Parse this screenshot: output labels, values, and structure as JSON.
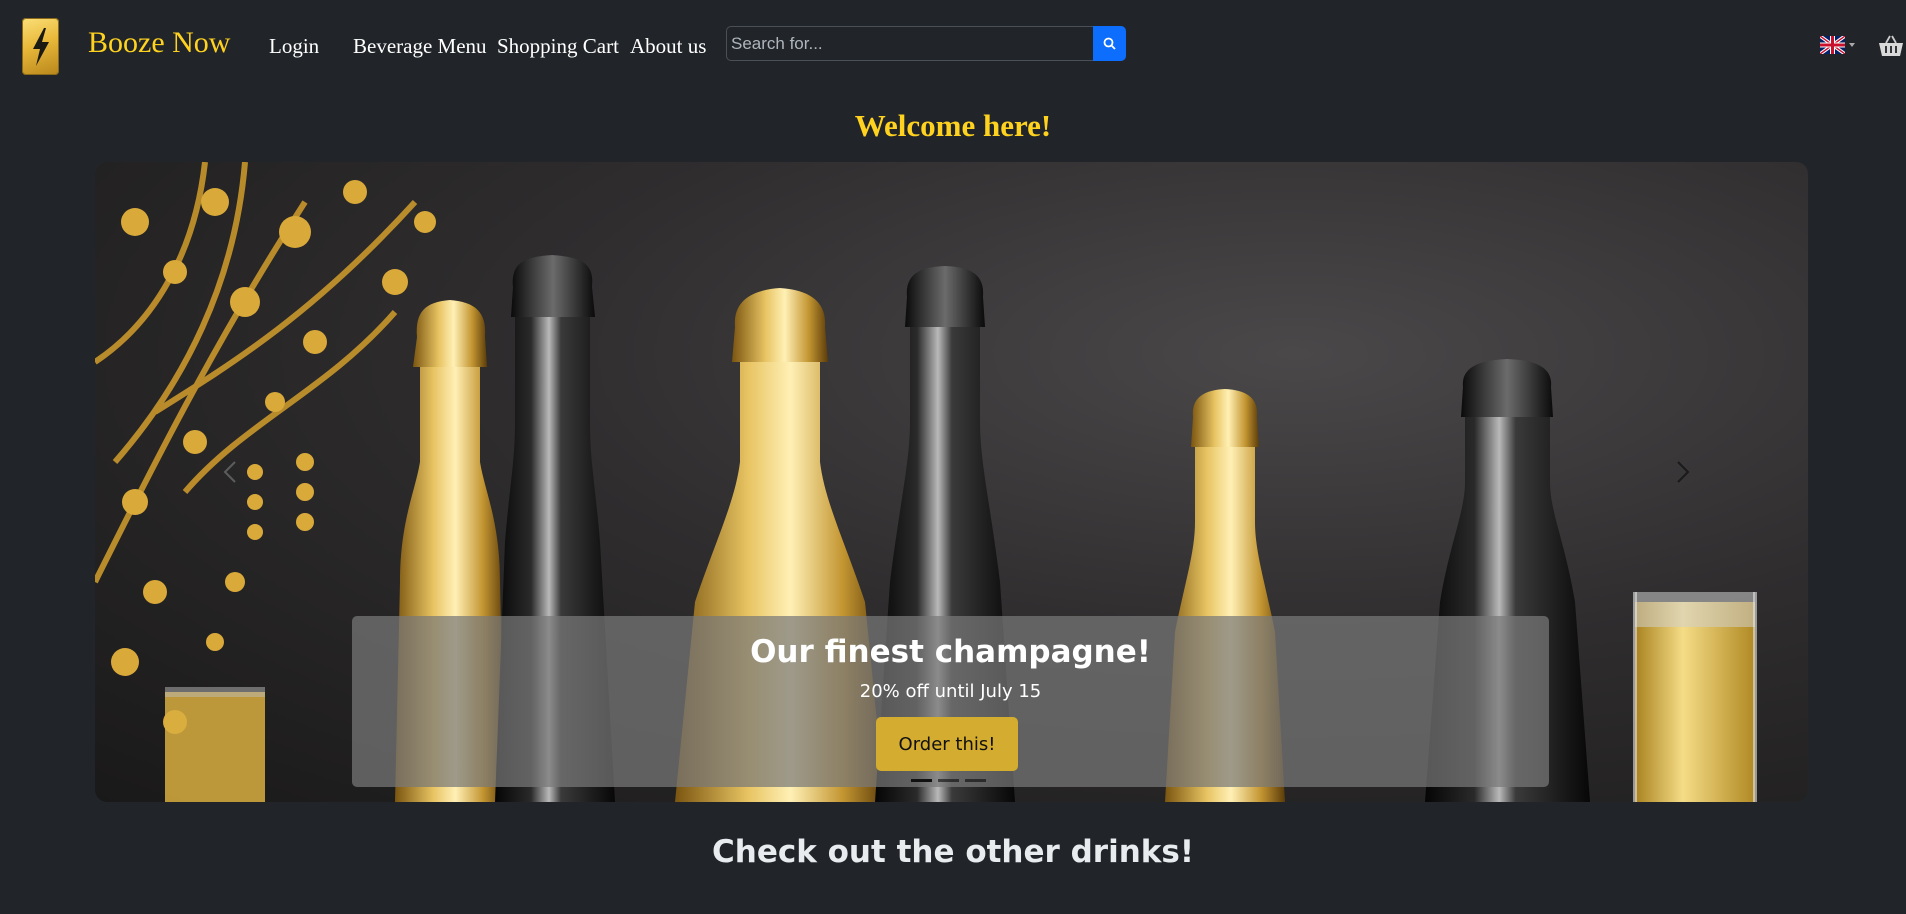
{
  "nav": {
    "brand": "Booze Now",
    "links": [
      "Login",
      "Beverage Menu",
      "Shopping Cart",
      "About us"
    ],
    "search_placeholder": "Search for...",
    "language_icon": "uk-flag-icon",
    "cart_icon": "basket-icon"
  },
  "hero": {
    "welcome": "Welcome here!",
    "slide": {
      "title": "Our finest champagne!",
      "subtitle": "20% off until July 15",
      "button": "Order this!"
    },
    "slides_count": 3,
    "active_slide": 1
  },
  "section": {
    "heading": "Check out the other drinks!"
  },
  "colors": {
    "background": "#212529",
    "brand_gold": "#ffd21f",
    "button_gold": "#d4ac2f",
    "search_blue": "#0d6efd"
  }
}
